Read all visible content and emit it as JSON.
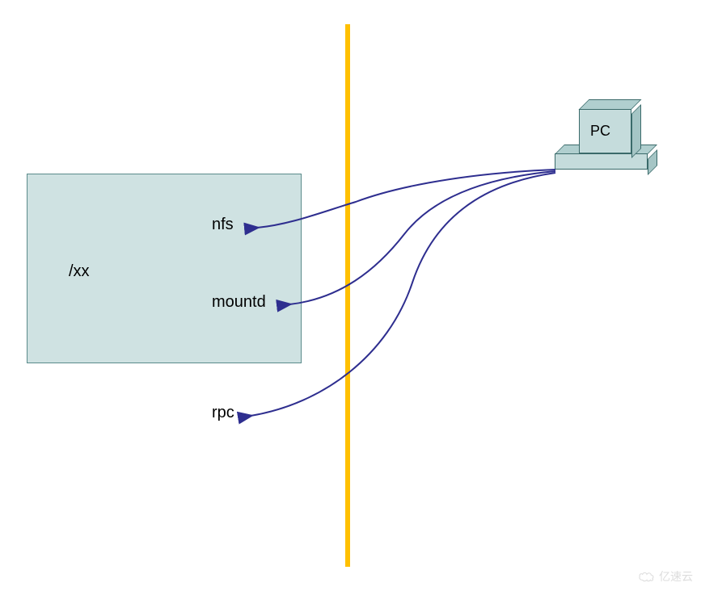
{
  "boxes": {
    "xx_label": "/xx",
    "pc_label": "PC"
  },
  "services": {
    "nfs_label": "nfs",
    "mountd_label": "mountd",
    "rpc_label": "rpc"
  },
  "colors": {
    "divider": "#FFC000",
    "box_fill": "#CFE2E2",
    "box_stroke": "#5A8A8A",
    "curve_stroke": "#2E2E8F"
  },
  "watermark": {
    "text": "亿速云"
  },
  "chart_data": {
    "type": "diagram",
    "title": "",
    "nodes": [
      {
        "id": "xx",
        "label": "/xx",
        "kind": "share-folder"
      },
      {
        "id": "nfs",
        "label": "nfs",
        "kind": "service"
      },
      {
        "id": "mountd",
        "label": "mountd",
        "kind": "service"
      },
      {
        "id": "rpc",
        "label": "rpc",
        "kind": "service"
      },
      {
        "id": "pc",
        "label": "PC",
        "kind": "client"
      }
    ],
    "edges": [
      {
        "from": "pc",
        "to": "nfs",
        "crosses_firewall": true
      },
      {
        "from": "pc",
        "to": "mountd",
        "crosses_firewall": true
      },
      {
        "from": "pc",
        "to": "rpc",
        "crosses_firewall": true
      }
    ],
    "divider": {
      "orientation": "vertical",
      "meaning": "firewall/boundary"
    }
  }
}
